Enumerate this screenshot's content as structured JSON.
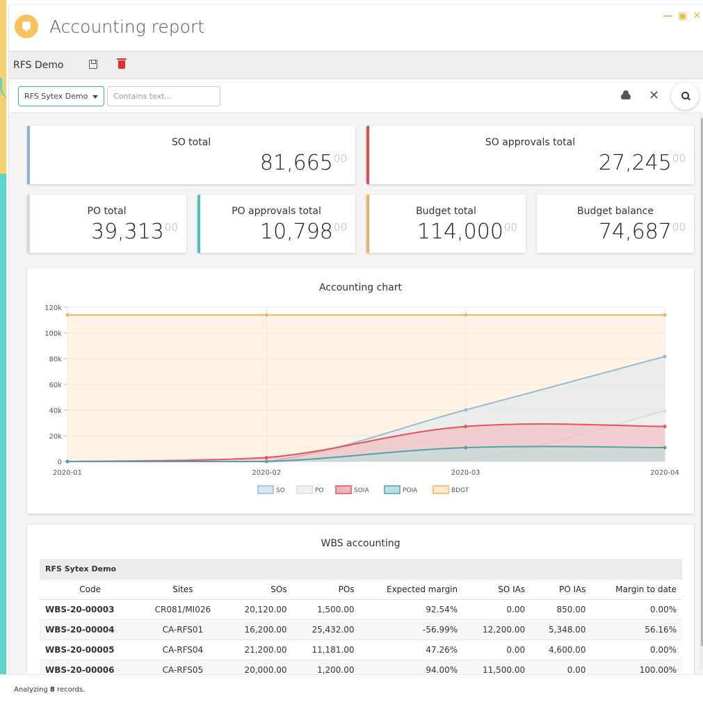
{
  "window": {
    "title": "Accounting report",
    "controls": {
      "minimize": "—",
      "restore": "▣",
      "close": "✕"
    }
  },
  "toolbar": {
    "report_name": "RFS Demo",
    "save_icon": "save-icon",
    "delete_icon": "trash-icon"
  },
  "filter": {
    "selected_project": "RFS Sytex Demo",
    "search_placeholder": "Contains text...",
    "search_value": "",
    "close_label": "✕"
  },
  "kpis": {
    "so_total": {
      "label": "SO total",
      "value": "81,665",
      "decimals": "00",
      "color": "#8fb3cf"
    },
    "so_approvals_total": {
      "label": "SO approvals total",
      "value": "27,245",
      "decimals": "00",
      "color": "#e5484d"
    },
    "po_total": {
      "label": "PO total",
      "value": "39,313",
      "decimals": "00",
      "color": "#d9d9d9"
    },
    "po_approvals_total": {
      "label": "PO approvals total",
      "value": "10,798",
      "decimals": "00",
      "color": "#4cc1c2"
    },
    "budget_total": {
      "label": "Budget total",
      "value": "114,000",
      "decimals": "00",
      "color": "#f4b060"
    },
    "budget_balance": {
      "label": "Budget balance",
      "value": "74,687",
      "decimals": "00",
      "color": "#ffffff"
    }
  },
  "chart_data": {
    "type": "area",
    "title": "Accounting chart",
    "x": [
      "2020-01",
      "2020-02",
      "2020-03",
      "2020-04"
    ],
    "ylim": [
      0,
      120000
    ],
    "yticks": [
      0,
      20000,
      40000,
      60000,
      80000,
      100000,
      120000
    ],
    "ytick_labels": [
      "0",
      "20k",
      "40k",
      "60k",
      "80k",
      "100k",
      "120k"
    ],
    "grid": true,
    "legend_position": "bottom",
    "series": [
      {
        "name": "SO",
        "values": [
          0,
          0,
          40120,
          81665
        ],
        "color": "#97bbd4",
        "fill": "#dbe7f0"
      },
      {
        "name": "PO",
        "values": [
          0,
          0,
          1500,
          39313
        ],
        "color": "#dcdcdc",
        "fill": "#f0f0f0"
      },
      {
        "name": "SOIA",
        "values": [
          0,
          3000,
          27245,
          27245
        ],
        "color": "#e8505b",
        "fill": "#f4b4b8"
      },
      {
        "name": "POIA",
        "values": [
          0,
          0,
          10798,
          10798
        ],
        "color": "#4fa3a8",
        "fill": "#b8e0e1"
      },
      {
        "name": "BDGT",
        "values": [
          114000,
          114000,
          114000,
          114000
        ],
        "color": "#f7b25f",
        "fill": "#fde9cf"
      }
    ]
  },
  "wbs": {
    "title": "WBS accounting",
    "group": "RFS Sytex Demo",
    "columns": [
      "Code",
      "Sites",
      "SOs",
      "POs",
      "Expected margin",
      "SO IAs",
      "PO IAs",
      "Margin to date"
    ],
    "rows": [
      [
        "WBS-20-00003",
        "CR081/MI026",
        "20,120.00",
        "1,500.00",
        "92.54%",
        "0.00",
        "850.00",
        "0.00%"
      ],
      [
        "WBS-20-00004",
        "CA-RFS01",
        "16,200.00",
        "25,432.00",
        "-56.99%",
        "12,200.00",
        "5,348.00",
        "56.16%"
      ],
      [
        "WBS-20-00005",
        "CA-RFS04",
        "21,200.00",
        "11,181.00",
        "47.26%",
        "0.00",
        "4,600.00",
        "0.00%"
      ],
      [
        "WBS-20-00006",
        "CA-RFS05",
        "20,000.00",
        "1,200.00",
        "94.00%",
        "11,500.00",
        "0.00",
        "100.00%"
      ]
    ]
  },
  "status": {
    "prefix": "Analyzing ",
    "count": "8",
    "suffix": " records."
  }
}
